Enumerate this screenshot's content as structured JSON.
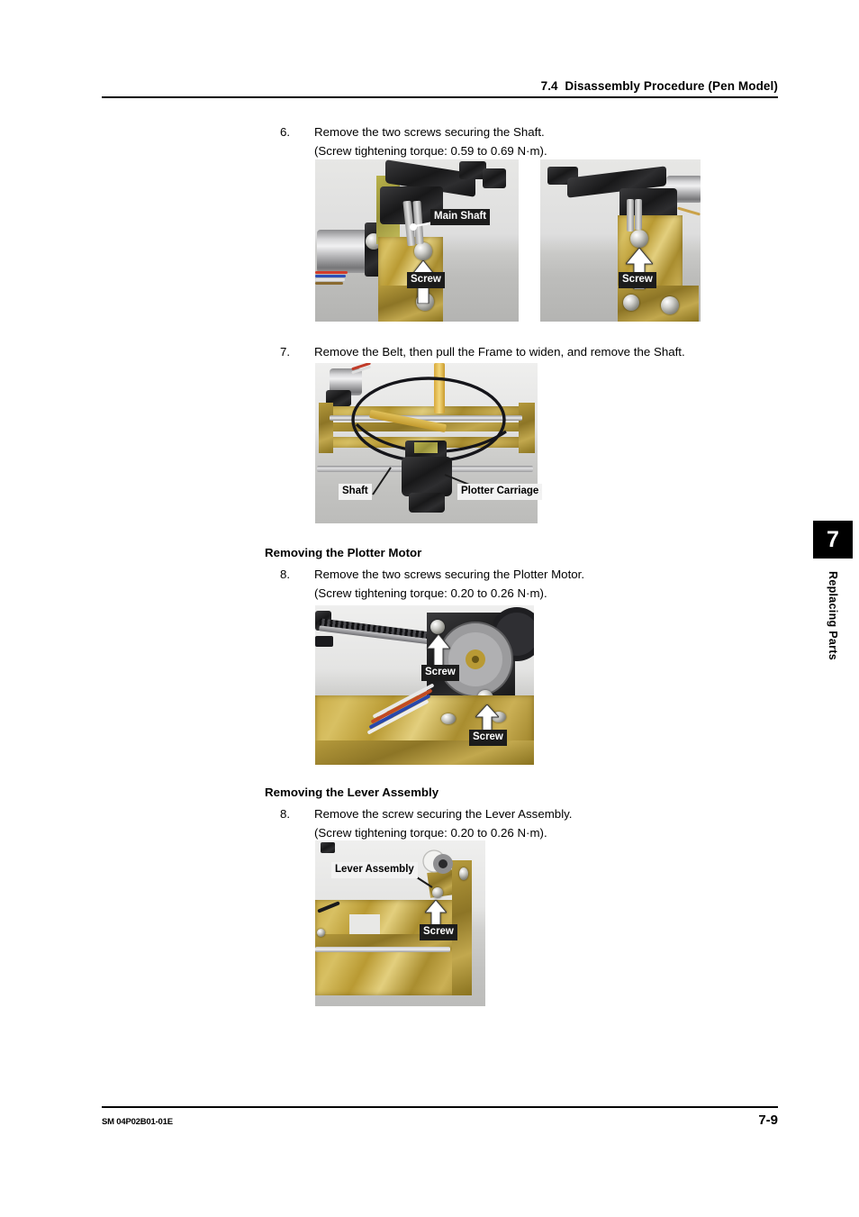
{
  "page": {
    "header_title": "7.4  Disassembly Procedure (Pen Model)",
    "footer_doc": "SM 04P02B01-01E",
    "footer_page": "7-9"
  },
  "chapter_tab": {
    "number": "7",
    "label": "Replacing Parts"
  },
  "steps": [
    {
      "number": "6.",
      "text": "Remove the two screws securing the Shaft.\n(Screw tightening torque: 0.59 to 0.69 N·m)."
    },
    {
      "number": "7.",
      "text": "Remove the Belt, then pull the Frame to widen, and remove the Shaft."
    },
    {
      "number": "8.",
      "text": "Remove the two screws securing the Plotter Motor.\n(Screw tightening torque: 0.20 to 0.26 N·m)."
    },
    {
      "number": "8.",
      "text": "Remove the screw securing the Lever Assembly.\n(Screw tightening torque: 0.20 to 0.26 N·m)."
    }
  ],
  "sections": [
    {
      "heading": "Removing the Plotter Motor"
    },
    {
      "heading": "Removing the Lever Assembly"
    }
  ],
  "figures": [
    {
      "name": "shaft-screw-left",
      "callouts": [
        {
          "text": "Main Shaft",
          "style": "dark"
        },
        {
          "text": "Screw",
          "style": "dark"
        }
      ]
    },
    {
      "name": "shaft-screw-right",
      "callouts": [
        {
          "text": "Screw",
          "style": "dark"
        }
      ]
    },
    {
      "name": "belt-frame-shaft",
      "callouts": [
        {
          "text": "Shaft",
          "style": "light"
        },
        {
          "text": "Plotter Carriage",
          "style": "light"
        }
      ]
    },
    {
      "name": "plotter-motor",
      "callouts": [
        {
          "text": "Screw",
          "style": "dark"
        },
        {
          "text": "Screw",
          "style": "dark"
        }
      ]
    },
    {
      "name": "lever-assembly",
      "callouts": [
        {
          "text": "Lever Assembly",
          "style": "light"
        },
        {
          "text": "Screw",
          "style": "dark"
        }
      ]
    }
  ]
}
